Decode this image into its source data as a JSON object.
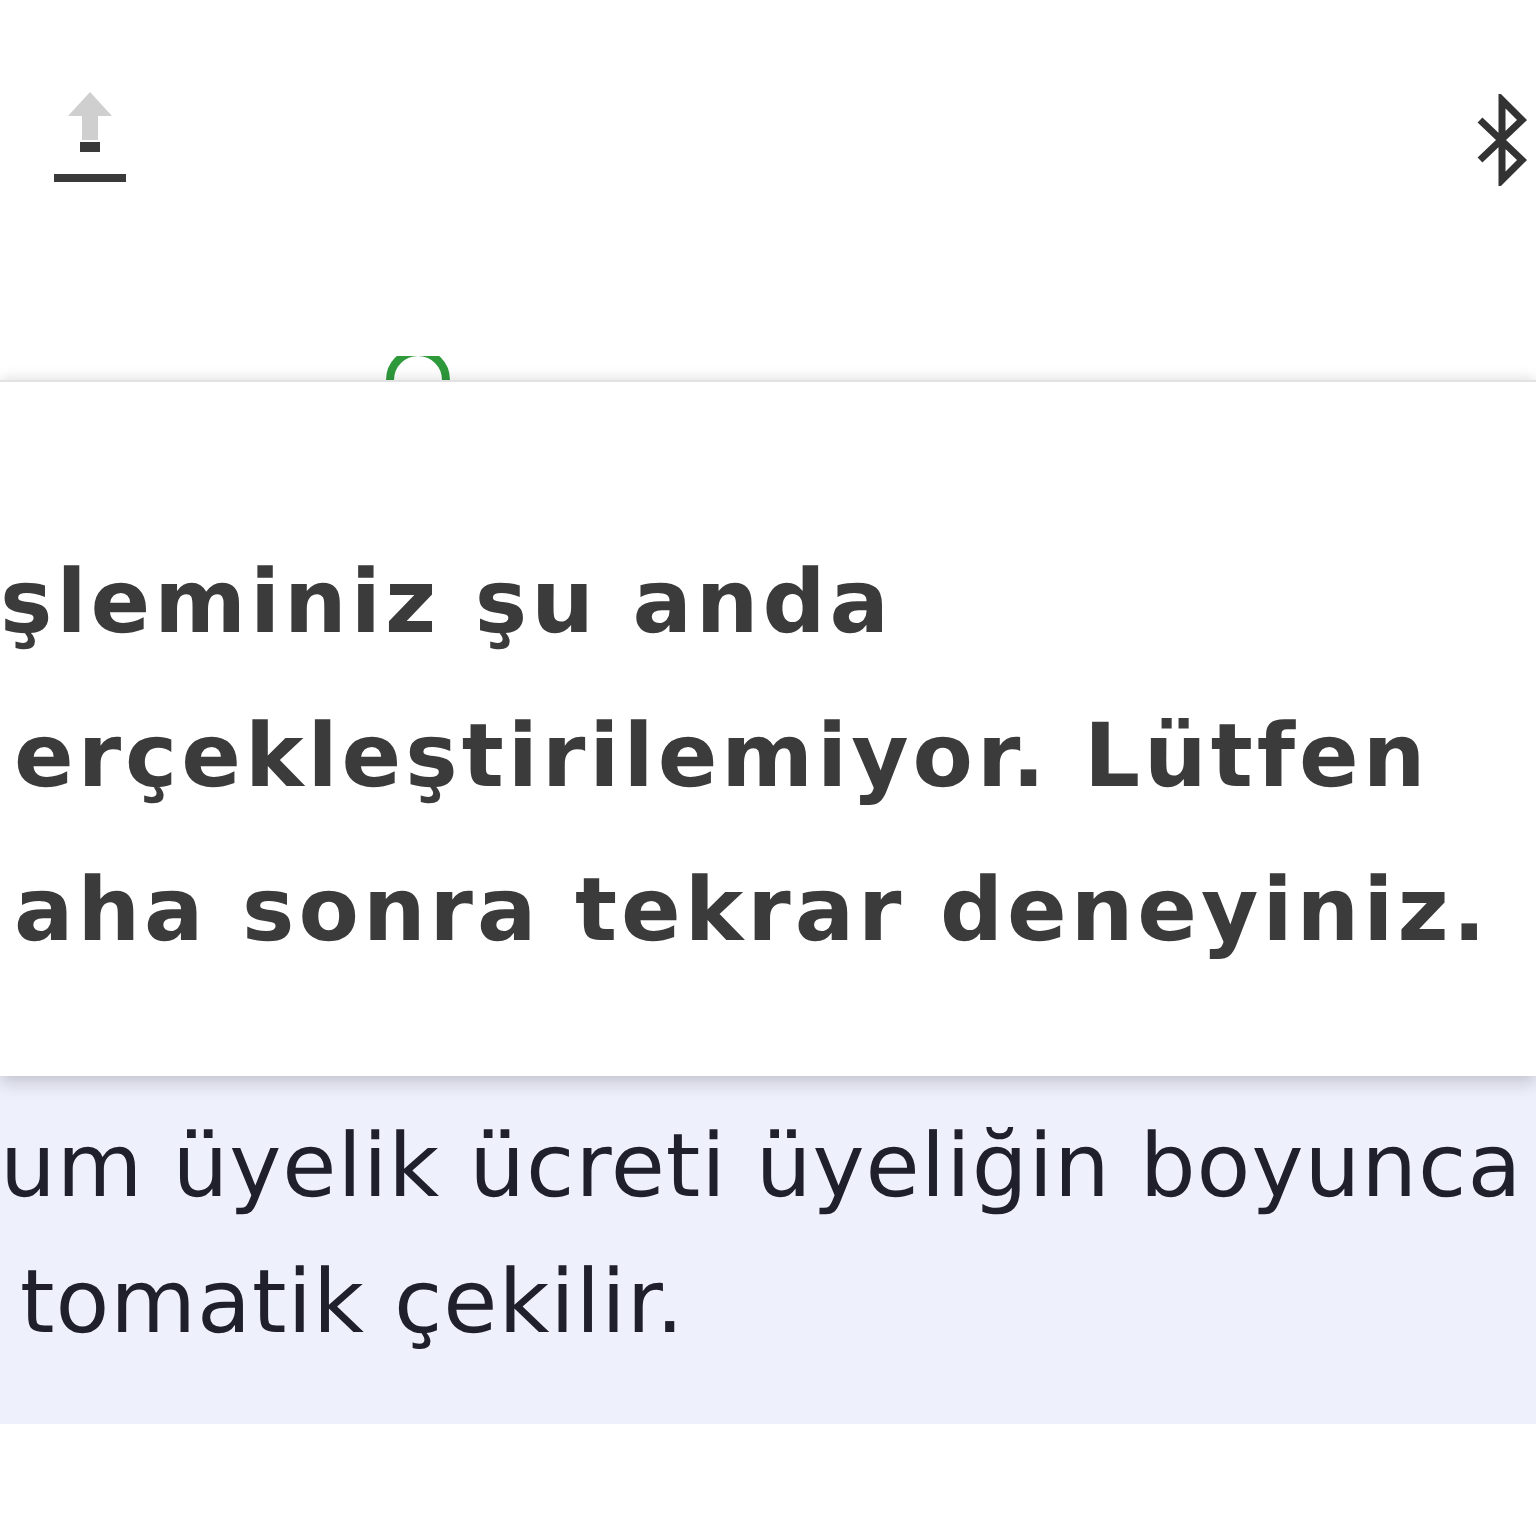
{
  "dialog": {
    "message_lines": [
      "şleminiz şu anda",
      "erçekleştirilemiyor. Lütfen",
      "aha sonra tekrar deneyiniz."
    ]
  },
  "note": {
    "lines": [
      "um üyelik ücreti üyeliğin boyunca",
      "tomatik çekilir."
    ]
  }
}
